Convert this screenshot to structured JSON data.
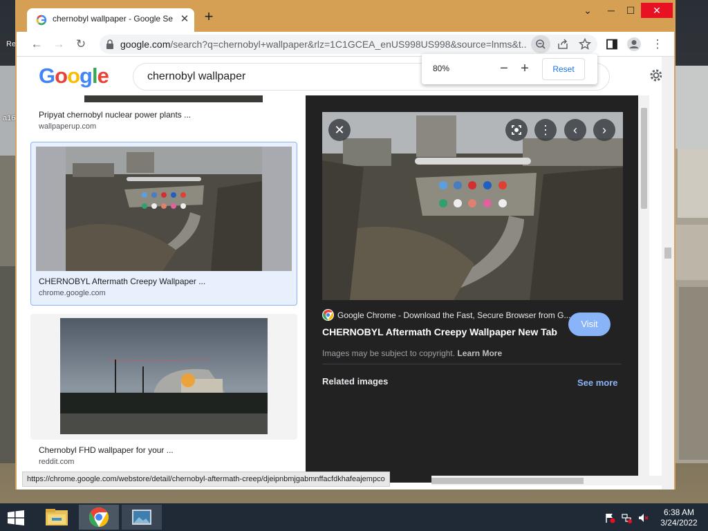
{
  "desktop": {
    "left_label": "Re",
    "left_label2": "a16"
  },
  "window": {
    "tab_title": "chernobyl wallpaper - Google Se",
    "tab_close": "✕",
    "new_tab": "+",
    "controls": {
      "menu": "⌄",
      "minimize": "─",
      "maximize": "☐",
      "close": "✕"
    }
  },
  "toolbar": {
    "back": "←",
    "forward": "→",
    "reload": "↻",
    "url_host": "google.com",
    "url_rest": "/search?q=chernobyl+wallpaper&rlz=1C1GCEA_enUS998US998&source=lnms&t...",
    "menu": "⋮"
  },
  "zoom_popup": {
    "percent": "80%",
    "minus": "−",
    "plus": "+",
    "reset": "Reset"
  },
  "google": {
    "logo_letters": [
      "G",
      "o",
      "o",
      "g",
      "l",
      "e"
    ],
    "logo_colors": [
      "#4285f4",
      "#ea4335",
      "#fbbc05",
      "#4285f4",
      "#34a853",
      "#ea4335"
    ],
    "query": "chernobyl wallpaper"
  },
  "results": [
    {
      "title": "Pripyat chernobyl nuclear power plants ...",
      "source": "wallpaperup.com"
    },
    {
      "title": "CHERNOBYL Aftermath Creepy Wallpaper ...",
      "source": "chrome.google.com"
    },
    {
      "title": "Chernobyl FHD wallpaper for your ...",
      "source": "reddit.com"
    }
  ],
  "preview": {
    "source": "Google Chrome - Download the Fast, Secure Browser from G...",
    "title": "CHERNOBYL Aftermath Creepy Wallpaper New Tab",
    "visit": "Visit",
    "copyright_text": "Images may be subject to copyright.",
    "learn_more": "Learn More",
    "related": "Related images",
    "see_more": "See more",
    "close": "✕",
    "prev": "‹",
    "next": "›",
    "more": "⋮"
  },
  "status_url": "https://chrome.google.com/webstore/detail/chernobyl-aftermath-creep/djeipnbmjgabmnffacfdkhafeajempco",
  "taskbar": {
    "time": "6:38 AM",
    "date": "3/24/2022"
  }
}
